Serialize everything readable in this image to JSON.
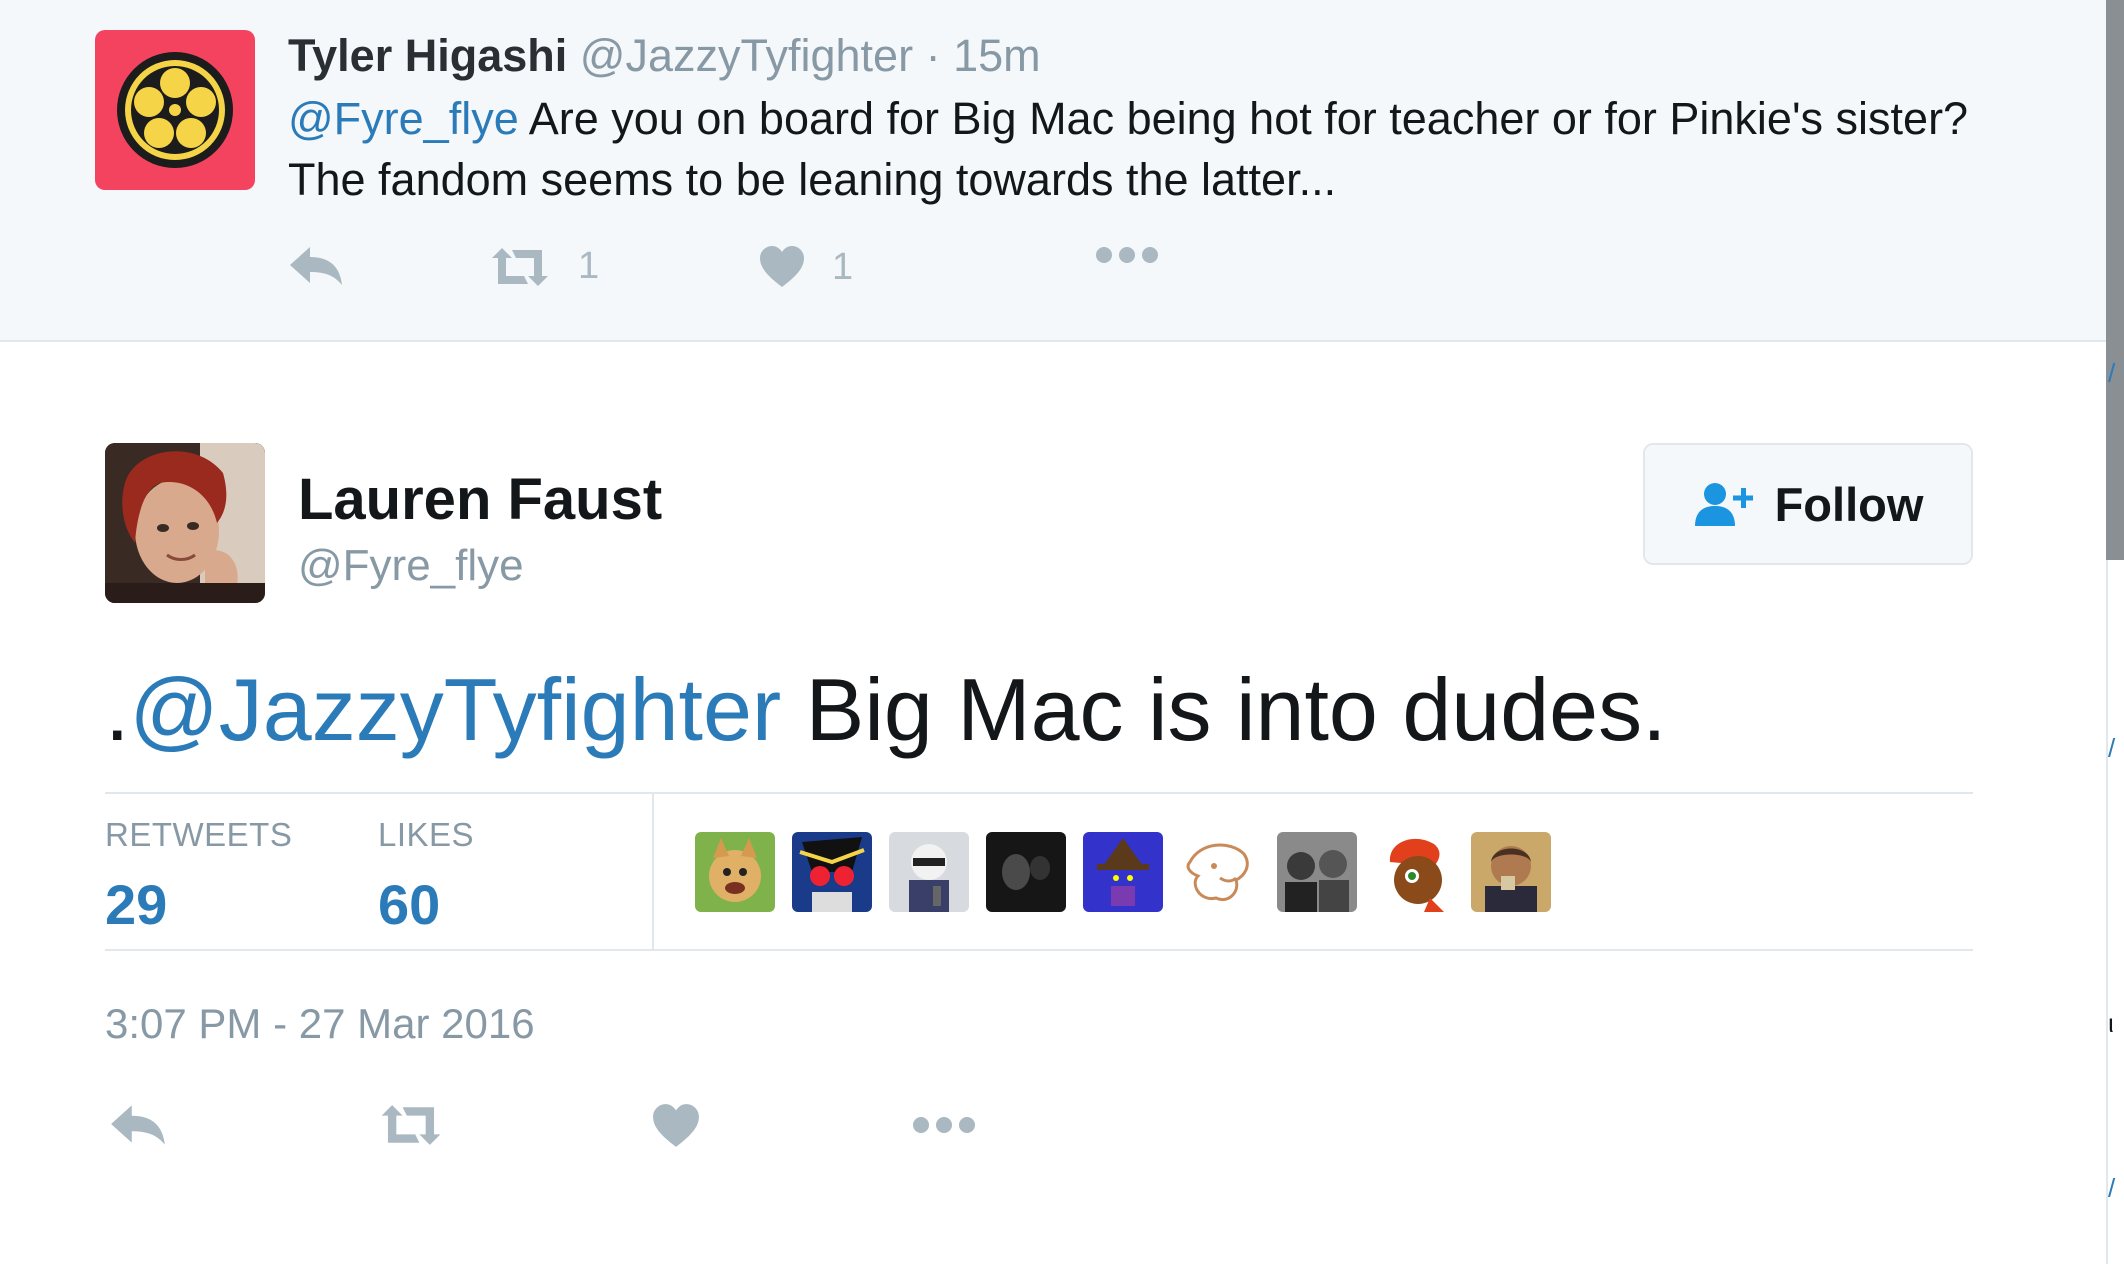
{
  "parent_tweet": {
    "name": "Tyler Higashi",
    "handle": "@JazzyTyfighter",
    "separator": "·",
    "time": "15m",
    "mention": "@Fyre_flye",
    "text": " Are you on board for Big Mac being hot for teacher or for Pinkie's sister? The fandom seems to be leaning towards the latter...",
    "retweet_count": "1",
    "like_count": "1",
    "avatar_icon": "crest-icon",
    "avatar_color": "#f4435f"
  },
  "main_tweet": {
    "name": "Lauren Faust",
    "handle": "@Fyre_flye",
    "follow_label": "Follow",
    "text_prefix": ".",
    "mention": "@JazzyTyfighter",
    "text": " Big Mac is into dudes.",
    "stats": {
      "retweets_label": "RETWEETS",
      "retweets_value": "29",
      "likes_label": "LIKES",
      "likes_value": "60"
    },
    "likers": [
      "liker-1",
      "liker-2",
      "liker-3",
      "liker-4",
      "liker-5",
      "liker-6",
      "liker-7",
      "liker-8",
      "liker-9"
    ],
    "timestamp": "3:07 PM - 27 Mar 2016"
  },
  "colors": {
    "link": "#2b7bb9",
    "muted": "#8899a6",
    "action_icon": "#aab8c2",
    "background_parent": "#f5f8fa"
  }
}
